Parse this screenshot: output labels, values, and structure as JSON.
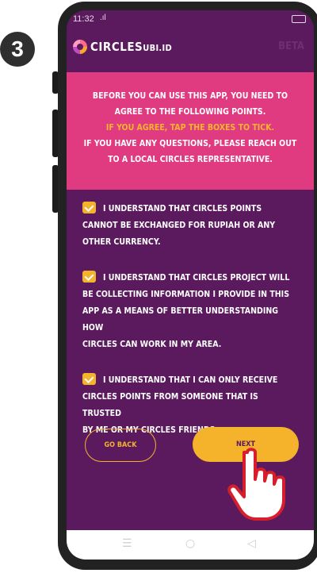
{
  "step_number": "3",
  "status_bar": {
    "time": "11:32",
    "signal": ".ıl"
  },
  "app_bar": {
    "brand_main": "CIRCLES",
    "brand_sub": "UBI.ID",
    "beta": "BETA"
  },
  "banner": {
    "line1": "BEFORE YOU CAN USE THIS APP, YOU NEED TO",
    "line2": "AGREE TO THE FOLLOWING POINTS.",
    "line3": "IF YOU AGREE, TAP THE BOXES TO TICK.",
    "line4": "IF YOU HAVE ANY QUESTIONS, PLEASE REACH OUT",
    "line5": "TO A LOCAL CIRCLES REPRESENTATIVE."
  },
  "agreements": [
    {
      "checked": true,
      "lines": [
        "I UNDERSTAND THAT CIRCLES POINTS",
        "CANNOT BE EXCHANGED FOR RUPIAH OR ANY",
        "OTHER CURRENCY."
      ]
    },
    {
      "checked": true,
      "lines": [
        "I UNDERSTAND THAT CIRCLES PROJECT WILL",
        "BE COLLECTING INFORMATION I PROVIDE IN THIS",
        "APP AS A MEANS OF BETTER UNDERSTANDING HOW",
        "CIRCLES CAN WORK IN MY AREA."
      ]
    },
    {
      "checked": true,
      "lines": [
        "I UNDERSTAND THAT I CAN ONLY RECEIVE",
        "CIRCLES POINTS FROM SOMEONE THAT IS TRUSTED",
        "BY ME OR MY CIRCLES FRIENDS."
      ]
    }
  ],
  "buttons": {
    "back": "GO BACK",
    "next": "NEXT"
  },
  "colors": {
    "background": "#5b1a5d",
    "banner": "#e03a80",
    "accent": "#f5b32c"
  },
  "icons": {
    "nav_menu": "☰",
    "nav_home": "○",
    "nav_back": "◁"
  }
}
